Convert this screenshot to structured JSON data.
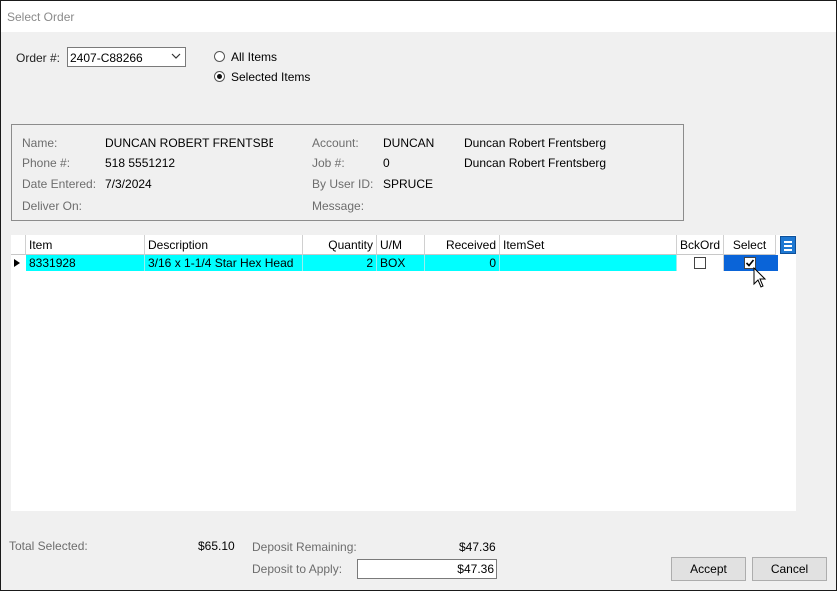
{
  "window": {
    "title": "Select Order"
  },
  "order": {
    "label": "Order #:",
    "value": "2407-C88266",
    "scope_options": [
      {
        "label": "All Items",
        "selected": false
      },
      {
        "label": "Selected Items",
        "selected": true
      }
    ]
  },
  "info": {
    "name_label": "Name:",
    "name_value": "DUNCAN ROBERT FRENTSBERG",
    "phone_label": "Phone #:",
    "phone_value": "518 5551212",
    "date_label": "Date Entered:",
    "date_value": "7/3/2024",
    "deliver_label": "Deliver On:",
    "deliver_value": "",
    "account_label": "Account:",
    "account_value": "DUNCAN",
    "account_name": "Duncan Robert Frentsberg",
    "job_label": "Job #:",
    "job_value": "0",
    "job_name": "Duncan Robert Frentsberg",
    "user_label": "By User ID:",
    "user_value": "SPRUCE",
    "message_label": "Message:",
    "message_value": ""
  },
  "grid": {
    "columns": [
      "Item",
      "Description",
      "Quantity",
      "U/M",
      "Received",
      "ItemSet",
      "BckOrd",
      "Select"
    ],
    "rows": [
      {
        "item": "8331928",
        "description": "3/16 x 1-1/4 Star Hex Head",
        "quantity": "2",
        "um": "BOX",
        "received": "0",
        "itemset": "",
        "bckord": false,
        "select": true
      }
    ]
  },
  "footer": {
    "total_selected_label": "Total Selected:",
    "total_selected_value": "$65.10",
    "deposit_remaining_label": "Deposit Remaining:",
    "deposit_remaining_value": "$47.36",
    "deposit_apply_label": "Deposit to Apply:",
    "deposit_apply_value": "$47.36",
    "accept_label": "Accept",
    "cancel_label": "Cancel"
  },
  "colors": {
    "row_highlight": "#00ffff",
    "select_cell": "#0a64d8",
    "menu_button": "#1e78d2"
  },
  "icons": {
    "combo": "chevron-down-icon",
    "row_indicator": "row-pointer-icon",
    "column_menu": "hamburger-menu-icon",
    "cursor": "mouse-cursor-icon"
  }
}
